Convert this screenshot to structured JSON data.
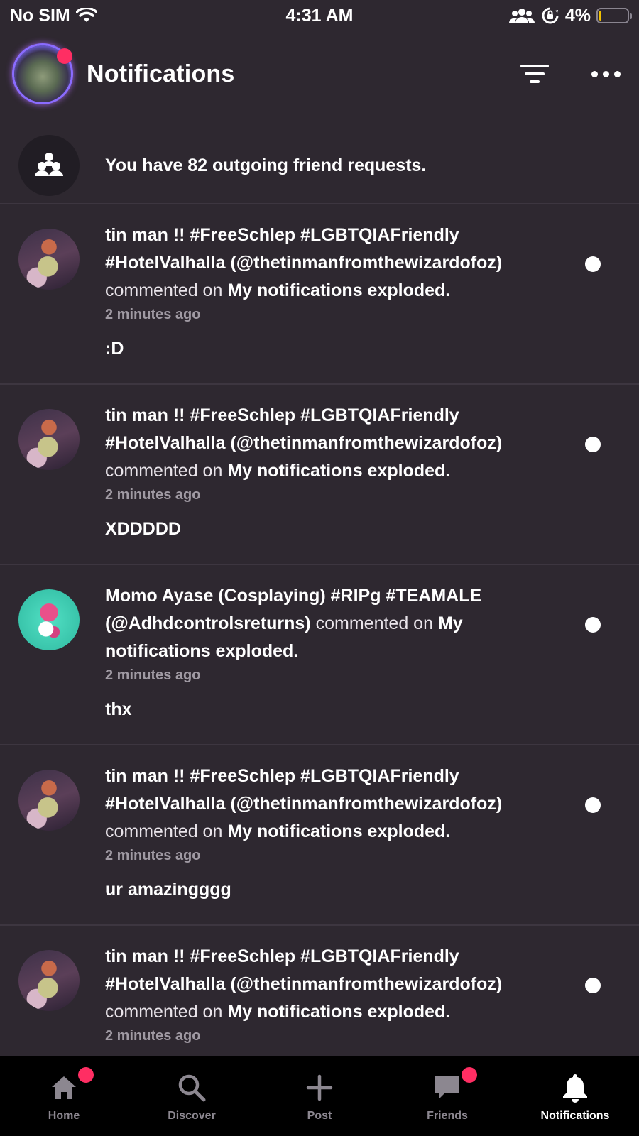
{
  "status_bar": {
    "carrier": "No SIM",
    "time": "4:31 AM",
    "battery": "4%",
    "battery_level": 0.04,
    "icons": [
      "wifi-icon",
      "people-icon",
      "orientation-lock-icon",
      "battery-icon"
    ]
  },
  "header": {
    "title": "Notifications",
    "icons": [
      "filter-icon",
      "more-icon"
    ],
    "has_unread_badge": true
  },
  "friend_requests": {
    "text": "You have 82 outgoing friend requests.",
    "icon": "friend-requests-icon"
  },
  "notifications": [
    {
      "avatar": "tin",
      "name_line1": "tin man !! #FreeSchlep #LGBTQIAFriendly",
      "name_line2": "#HotelValhalla (@thetinmanfromthewizardofoz)",
      "action": "commented on",
      "post": "My notifications exploded.",
      "time": "2 minutes ago",
      "comment": ":D",
      "unread": true
    },
    {
      "avatar": "tin",
      "name_line1": "tin man !! #FreeSchlep #LGBTQIAFriendly",
      "name_line2": "#HotelValhalla (@thetinmanfromthewizardofoz)",
      "action": "commented on",
      "post": "My notifications exploded.",
      "time": "2 minutes ago",
      "comment": "XDDDDD",
      "unread": true
    },
    {
      "avatar": "momo",
      "name_line1": "Momo Ayase (Cosplaying) #RIPg #TEAMALE",
      "name_line2": "(@Adhdcontrolsreturns)",
      "action": "commented on",
      "post_part1": "My",
      "post_part2": "notifications exploded.",
      "time": "2 minutes ago",
      "comment": "thx",
      "unread": true
    },
    {
      "avatar": "tin",
      "name_line1": "tin man !! #FreeSchlep #LGBTQIAFriendly",
      "name_line2": "#HotelValhalla (@thetinmanfromthewizardofoz)",
      "action": "commented on",
      "post": "My notifications exploded.",
      "time": "2 minutes ago",
      "comment": "ur amazingggg",
      "unread": true
    },
    {
      "avatar": "tin",
      "name_line1": "tin man !! #FreeSchlep #LGBTQIAFriendly",
      "name_line2": "#HotelValhalla (@thetinmanfromthewizardofoz)",
      "action": "commented on",
      "post": "My notifications exploded.",
      "time": "2 minutes ago",
      "unread": true
    }
  ],
  "bottom_nav": [
    {
      "label": "Home",
      "icon": "home-icon",
      "badge": true,
      "active": false
    },
    {
      "label": "Discover",
      "icon": "search-icon",
      "badge": false,
      "active": false
    },
    {
      "label": "Post",
      "icon": "plus-icon",
      "badge": false,
      "active": false
    },
    {
      "label": "Friends",
      "icon": "chat-bubble-icon",
      "badge": true,
      "active": false
    },
    {
      "label": "Notifications",
      "icon": "bell-icon",
      "badge": false,
      "active": true
    }
  ],
  "colors": {
    "background": "#2e2830",
    "badge": "#ff2e63",
    "nav_background": "#000000",
    "muted_text": "#a09aa3"
  }
}
